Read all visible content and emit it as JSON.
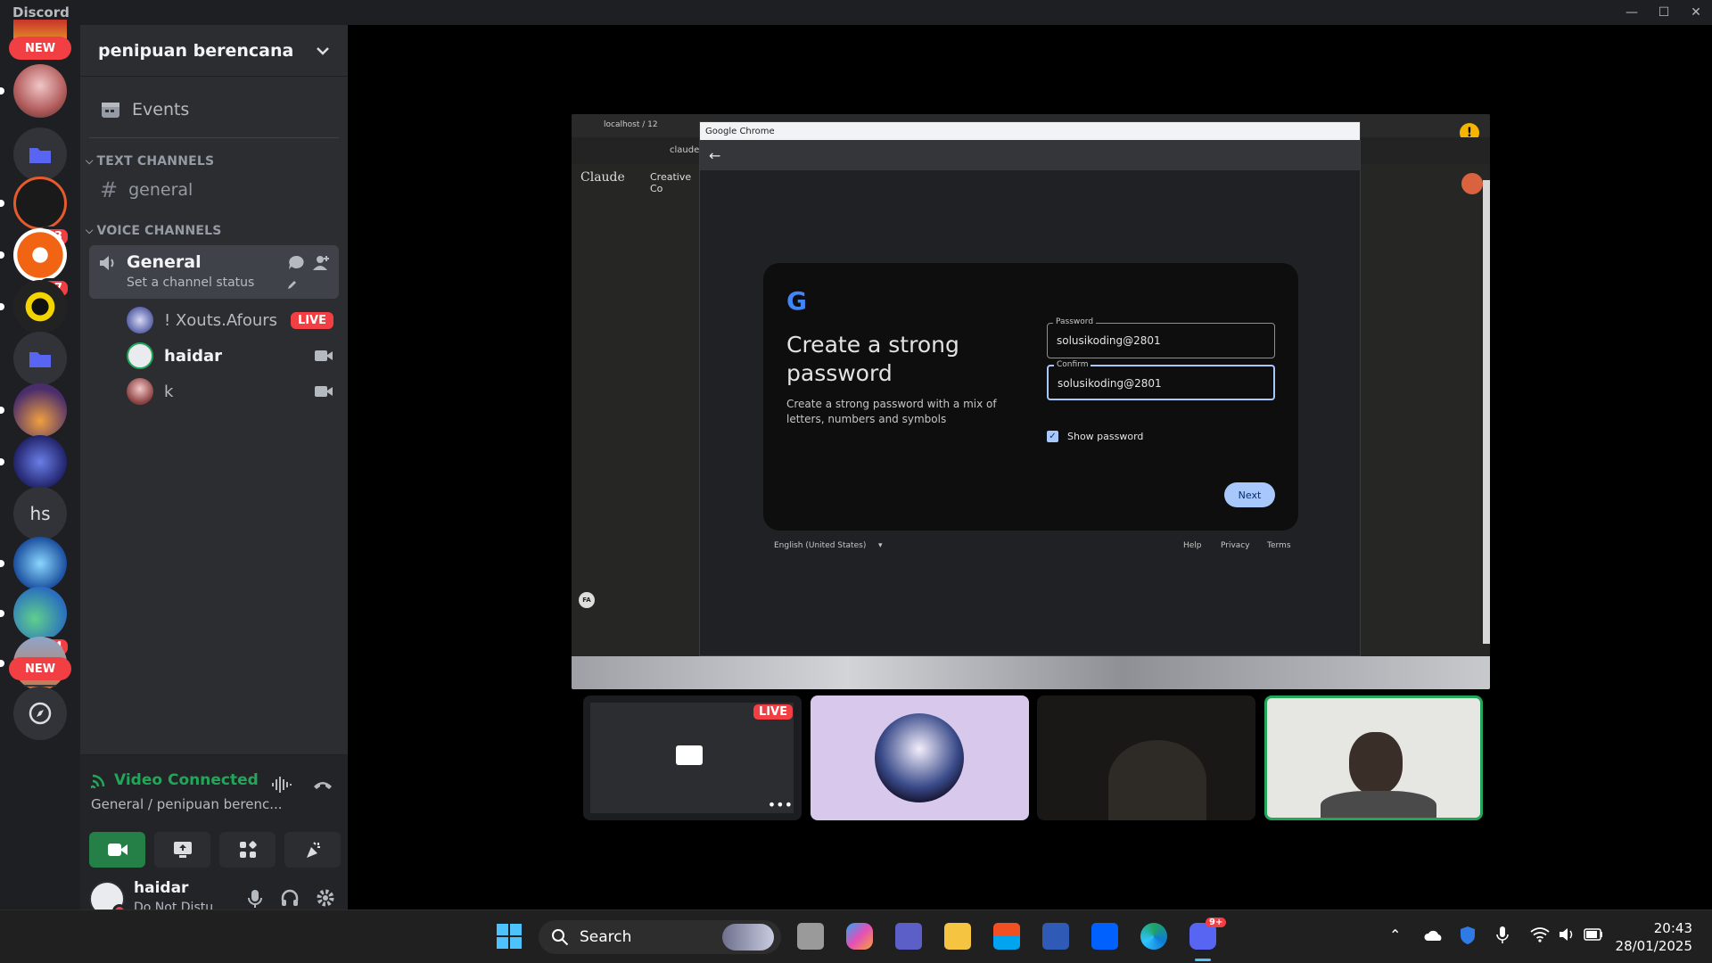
{
  "window": {
    "app_title": "Discord",
    "minimize": "—",
    "maximize": "☐",
    "close": "✕"
  },
  "rail": {
    "new_top": "NEW",
    "new_bottom": "NEW",
    "badge_1": "23",
    "badge_2": "27",
    "badge_3": "44",
    "server_hs": "hs"
  },
  "sidebar": {
    "server_name": "penipuan berencana",
    "events_label": "Events",
    "text_category": "TEXT CHANNELS",
    "text_channels": [
      {
        "label": "general"
      }
    ],
    "voice_category": "VOICE CHANNELS",
    "voice_channel": {
      "label": "General",
      "status": "Set a channel status"
    },
    "voice_users": [
      {
        "name": "! Xouts.Afours",
        "tag": "LIVE"
      },
      {
        "name": "haidar"
      },
      {
        "name": "k"
      }
    ]
  },
  "rtc": {
    "status": "Video Connected",
    "location": "General / penipuan berenc..."
  },
  "user": {
    "name": "haidar",
    "status": "Do Not Distu..."
  },
  "stream": {
    "tab_title": "localhost / 12",
    "left_brand": "Claude",
    "left_link": "Creative Co",
    "url_fragment": "claude.",
    "popup_title": "Google Chrome",
    "card_logo": "G",
    "card_title": "Create a strong password",
    "card_desc": "Create a strong password with a mix of letters, numbers and symbols",
    "password_label": "Password",
    "password_value": "solusikoding@2801",
    "confirm_label": "Confirm",
    "confirm_value": "solusikoding@2801",
    "show_password": "Show password",
    "next_button": "Next",
    "footer_lang": "English (United States)",
    "footer_help": "Help",
    "footer_privacy": "Privacy",
    "footer_terms": "Terms",
    "avatar_fa": "FA"
  },
  "tiles": {
    "live_tag": "LIVE"
  },
  "taskbar": {
    "search": "Search",
    "time": "20:43",
    "date": "28/01/2025",
    "discord_badge": "9+"
  },
  "colors": {
    "discord_green": "#23a55a",
    "discord_red": "#f23f43",
    "google_blue": "#a8c7fa"
  }
}
